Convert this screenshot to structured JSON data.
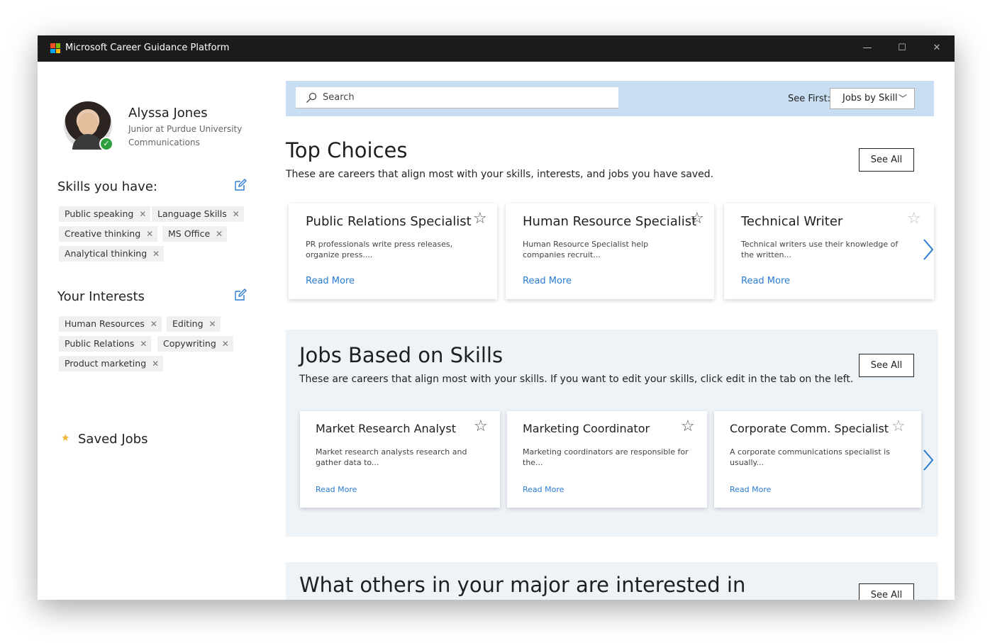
{
  "window": {
    "title": "Microsoft Career Guidance Platform",
    "logo_colors": [
      "#f25022",
      "#7fba00",
      "#00a4ef",
      "#ffb900"
    ],
    "controls": {
      "minimize": "—",
      "maximize": "☐",
      "close": "✕"
    }
  },
  "profile": {
    "name": "Alyssa Jones",
    "line1": "Junior at Purdue University",
    "line2": "Communications",
    "status": "✓"
  },
  "skills": {
    "title": "Skills you have:",
    "items": [
      "Public speaking",
      "Language Skills",
      "Creative thinking",
      "MS Office",
      "Analytical thinking"
    ]
  },
  "interests": {
    "title": "Your Interests",
    "items": [
      "Human Resources",
      "Editing",
      "Public Relations",
      "Copywriting",
      "Product marketing"
    ]
  },
  "tag_remove_glyph": "✕",
  "saved": {
    "star": "★",
    "label": "Saved Jobs"
  },
  "search": {
    "placeholder": "Search",
    "see_first_label": "See First:",
    "see_first_value": "Jobs by Skill",
    "chevron": "﹀"
  },
  "top_choices": {
    "title": "Top Choices",
    "description": "These are careers that align most with your skills, interests, and jobs you have saved.",
    "see_all": "See All",
    "cards": [
      {
        "title": "Public Relations Specialist",
        "desc": "PR professionals write press releases, organize press....",
        "link": "Read More"
      },
      {
        "title": "Human Resource Specialist",
        "desc": "Human Resource Specialist help companies recruit...",
        "link": "Read More"
      },
      {
        "title": "Technical Writer",
        "desc": "Technical writers use their knowledge of the written...",
        "link": "Read More"
      }
    ]
  },
  "jobs_skills": {
    "title": "Jobs Based on Skills",
    "description": "These are careers that align most with your skills. If you want to edit your skills, click edit in the tab on the left.",
    "see_all": "See All",
    "cards": [
      {
        "title": "Market Research Analyst",
        "desc": "Market research analysts research and gather data to...",
        "link": "Read More"
      },
      {
        "title": "Marketing Coordinator",
        "desc": "Marketing coordinators are responsible for the...",
        "link": "Read More"
      },
      {
        "title": "Corporate Comm. Specialist",
        "desc": "A corporate communications specialist is usually...",
        "link": "Read More"
      }
    ]
  },
  "others": {
    "title": "What others in your major are interested in",
    "see_all": "See All"
  },
  "star_glyph": "☆",
  "accent": "#2b7cd3"
}
